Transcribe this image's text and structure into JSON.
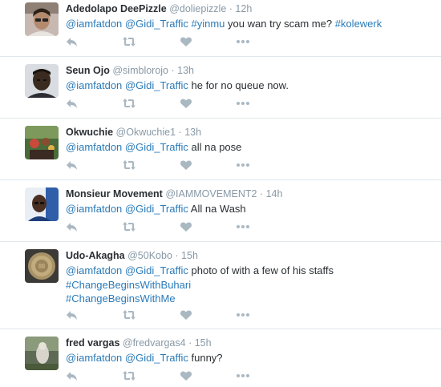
{
  "tweets": [
    {
      "name": "Adedolapo DeePizzle",
      "handle": "@doliepizzle",
      "time": "12h",
      "mentions": [
        "@iamfatdon",
        "@Gidi_Traffic"
      ],
      "hashtag_1": "#yinmu",
      "text_1": "you wan try scam me?",
      "hashtag_2": "#kolewerk"
    },
    {
      "name": "Seun Ojo",
      "handle": "@simblorojo",
      "time": "13h",
      "mentions": [
        "@iamfatdon",
        "@Gidi_Traffic"
      ],
      "text_1": "he for no queue now."
    },
    {
      "name": "Okwuchie",
      "handle": "@Okwuchie1",
      "time": "13h",
      "mentions": [
        "@iamfatdon",
        "@Gidi_Traffic"
      ],
      "text_1": "all na pose"
    },
    {
      "name": "Monsieur Movement",
      "handle": "@IAMMOVEMENT2",
      "time": "14h",
      "mentions": [
        "@iamfatdon",
        "@Gidi_Traffic"
      ],
      "text_1": "All na Wash"
    },
    {
      "name": "Udo-Akagha",
      "handle": "@50Kobo",
      "time": "15h",
      "mentions": [
        "@iamfatdon",
        "@Gidi_Traffic"
      ],
      "text_1": "photo of with a few of his staffs",
      "hashtag_1": "#ChangeBeginsWithBuhari",
      "hashtag_2": "#ChangeBeginsWithMe"
    },
    {
      "name": "fred vargas",
      "handle": "@fredvargas4",
      "time": "15h",
      "mentions": [
        "@iamfatdon",
        "@Gidi_Traffic"
      ],
      "text_1": "funny?"
    }
  ],
  "dot": "·",
  "icons": {
    "reply": "reply-icon",
    "retweet": "retweet-icon",
    "like": "heart-icon",
    "more": "more-icon"
  },
  "colors": {
    "link": "#2b7bb9",
    "meta": "#8899a6",
    "icon": "#aab8c2",
    "divider": "#e1e8ed"
  }
}
